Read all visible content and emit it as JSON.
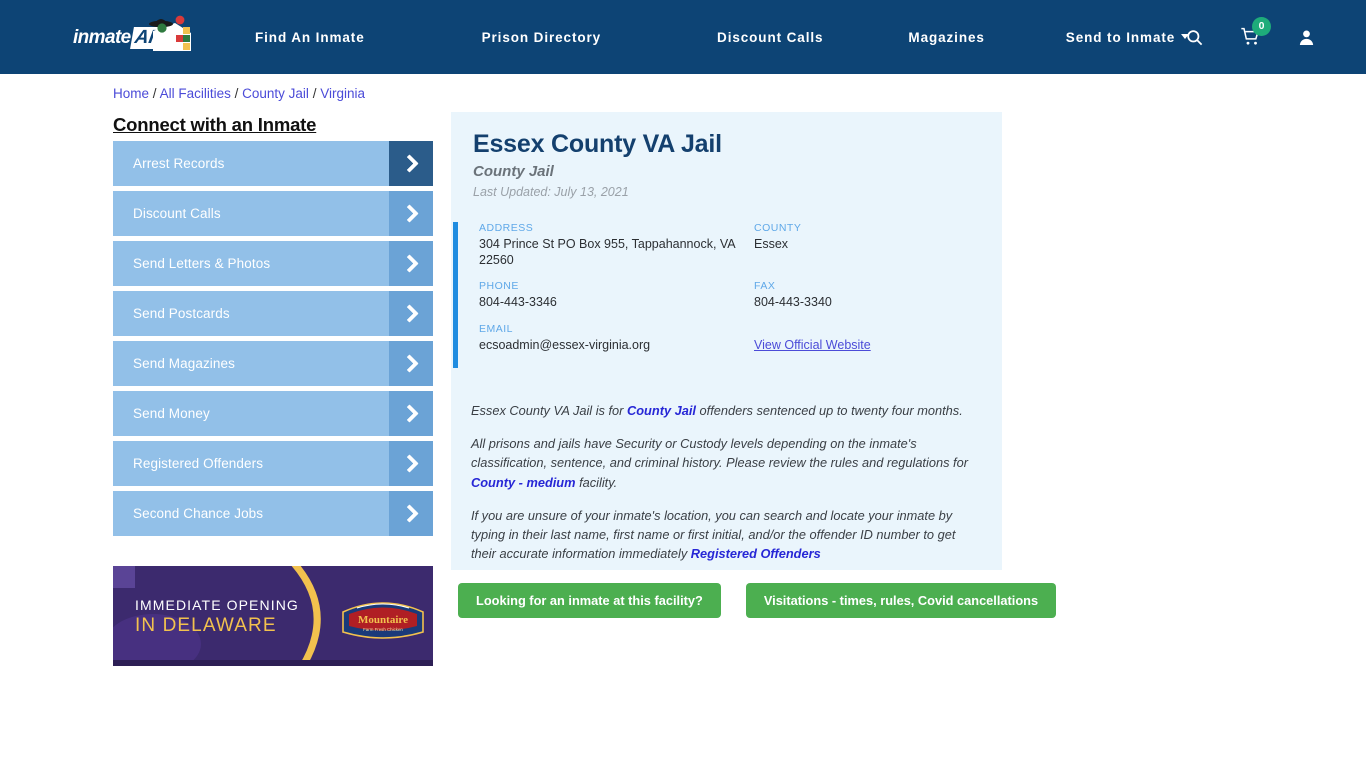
{
  "header": {
    "logo_text": "inmate",
    "logo_badge": "AID",
    "nav": [
      {
        "label": "Find An Inmate",
        "has_caret": false
      },
      {
        "label": "Prison Directory",
        "has_caret": false
      },
      {
        "label": "Discount Calls",
        "has_caret": false
      },
      {
        "label": "Magazines",
        "has_caret": false
      },
      {
        "label": "Send to Inmate",
        "has_caret": true
      }
    ],
    "icons": {
      "search": "search-icon",
      "cart": "shopping-cart-icon",
      "cart_count": "0",
      "account": "user-account-icon"
    },
    "bar_color": "#0d4475",
    "badge_color": "#1eac7a"
  },
  "breadcrumb": {
    "items": [
      "Home",
      "All Facilities",
      "County Jail",
      "Virginia"
    ],
    "separator": "/",
    "link_color": "#4b4bd8"
  },
  "sidebar": {
    "heading": "Connect with an Inmate",
    "items": [
      {
        "label": "Arrest Records"
      },
      {
        "label": "Discount Calls"
      },
      {
        "label": "Send Letters & Photos"
      },
      {
        "label": "Send Postcards"
      },
      {
        "label": "Send Magazines"
      },
      {
        "label": "Send Money"
      },
      {
        "label": "Registered Offenders"
      },
      {
        "label": "Second Chance Jobs"
      }
    ],
    "button_color": "#92c0e8",
    "arrow_color": "#6ba3d6",
    "arrow_color_active": "#2b5c8a"
  },
  "ad": {
    "line1": "IMMEDIATE OPENING",
    "line2": "IN DELAWARE",
    "brand": "Mountaire",
    "brand_sub": "Farm Fresh Chicken",
    "bg_color": "#3c2a6e",
    "accent_color": "#f2c14e"
  },
  "facility": {
    "title": "Essex County VA Jail",
    "subtitle": "County Jail",
    "last_updated": "Last Updated: July 13, 2021",
    "contact": {
      "address_label": "ADDRESS",
      "address_value": "304 Prince St PO Box 955, Tappahannock, VA 22560",
      "county_label": "COUNTY",
      "county_value": "Essex",
      "phone_label": "PHONE",
      "phone_value": "804-443-3346",
      "fax_label": "FAX",
      "fax_value": "804-443-3340",
      "email_label": "EMAIL",
      "email_value": "ecsoadmin@essex-virginia.org",
      "website_link": "View Official Website"
    },
    "paragraphs": {
      "p1_a": "Essex County VA Jail is for ",
      "p1_link": "County Jail",
      "p1_b": " offenders sentenced up to twenty four months.",
      "p2_a": "All prisons and jails have Security or Custody levels depending on the inmate's classification, sentence, and criminal history. Please review the rules and regulations for ",
      "p2_link": "County - medium",
      "p2_b": " facility.",
      "p3_a": "If you are unsure of your inmate's location, you can search and locate your inmate by typing in their last name, first name or first initial, and/or the offender ID number to get their accurate information immediately ",
      "p3_link": "Registered Offenders"
    },
    "actions": [
      {
        "label": "Looking for an inmate at this facility?"
      },
      {
        "label": "Visitations - times, rules, Covid cancellations"
      }
    ],
    "card_bg": "#eaf5fc",
    "accent_bar": "#1f8ce0",
    "button_color": "#4caf50"
  }
}
